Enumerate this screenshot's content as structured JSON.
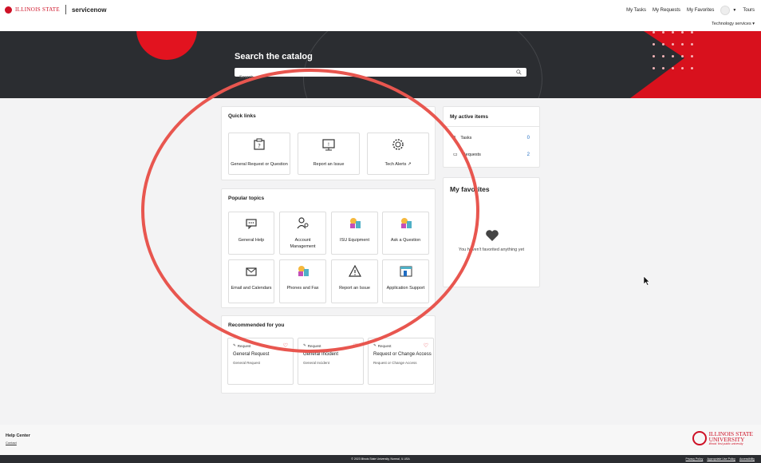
{
  "header": {
    "brand_isu": "ILLINOIS STATE",
    "brand_sn": "servicenow",
    "nav": [
      "My Tasks",
      "My Requests",
      "My Favorites",
      "Tours"
    ],
    "tech_services": "Technology services"
  },
  "hero": {
    "title": "Search the catalog",
    "search_placeholder": "Search"
  },
  "quick_links": {
    "title": "Quick links",
    "items": [
      {
        "label": "General Request or Question",
        "icon": "clipboard-question-icon"
      },
      {
        "label": "Report an Issue",
        "icon": "monitor-alert-icon"
      },
      {
        "label": "Tech Alerts",
        "icon": "gear-alert-icon",
        "external": true
      }
    ]
  },
  "popular_topics": {
    "title": "Popular topics",
    "items": [
      {
        "label": "General Help",
        "icon": "chat-icon"
      },
      {
        "label": "Account Management",
        "icon": "user-key-icon"
      },
      {
        "label": "ISU Equipment",
        "icon": "shapes-icon"
      },
      {
        "label": "Ask a Question",
        "icon": "shapes-icon"
      },
      {
        "label": "Email and Calendars",
        "icon": "envelope-check-icon"
      },
      {
        "label": "Phones and Fax",
        "icon": "shapes-icon"
      },
      {
        "label": "Report an Issue",
        "icon": "warning-triangle-icon"
      },
      {
        "label": "Application Support",
        "icon": "app-window-icon"
      }
    ]
  },
  "recommended": {
    "title": "Recommended for you",
    "items": [
      {
        "tag": "Request",
        "title": "General Request",
        "sub": "General Request"
      },
      {
        "tag": "Request",
        "title": "General Incident",
        "sub": "General Incident"
      },
      {
        "tag": "Request",
        "title": "Request or Change Access",
        "sub": "Request or Change Access"
      }
    ]
  },
  "active_items": {
    "title": "My active items",
    "rows": [
      {
        "label": "Tasks",
        "count": "0"
      },
      {
        "label": "Requests",
        "count": "2"
      }
    ]
  },
  "favorites": {
    "title": "My favorites",
    "empty": "You haven't favorited anything yet"
  },
  "footer": {
    "help_center": "Help Center",
    "contact": "Contact",
    "isu_line1": "ILLINOIS STATE",
    "isu_line2": "UNIVERSITY",
    "isu_tagline": "Illinois' first public university",
    "copyright": "© 2023 Illinois State University, Normal, IL USA",
    "links": [
      "Privacy Policy",
      "Appropriate Use Policy",
      "Accessibility"
    ]
  },
  "colors": {
    "brand_red": "#e2131f",
    "hero_dark": "#2b2d31",
    "link_blue": "#1f6cc2",
    "magnifier": "#e8564f"
  }
}
